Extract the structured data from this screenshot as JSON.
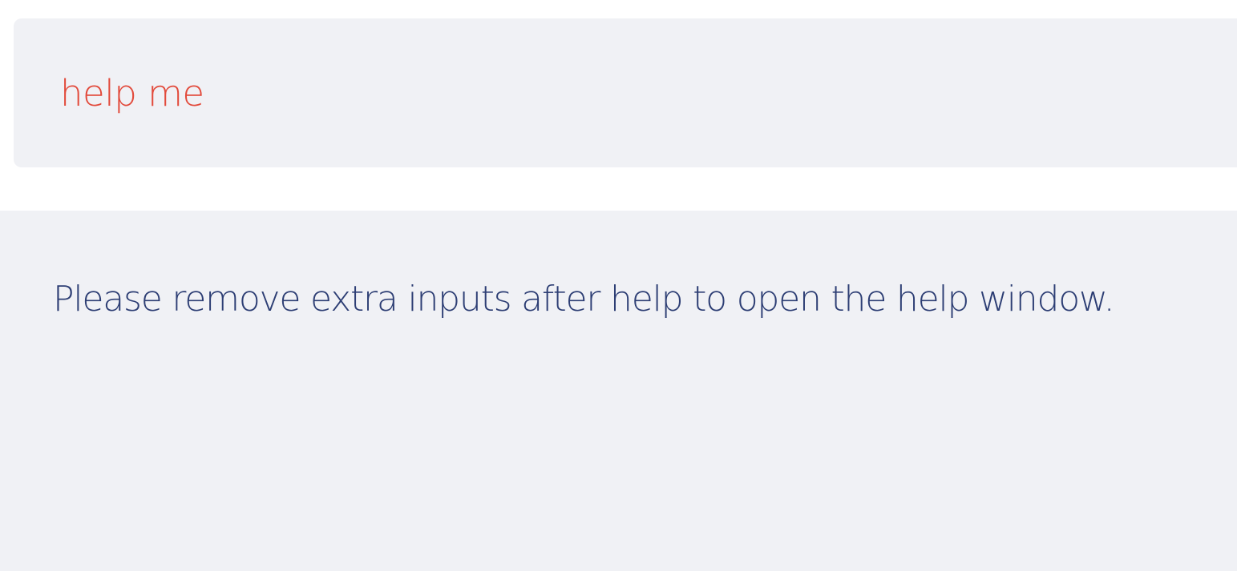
{
  "command": {
    "text": "help me",
    "color": "#e24a3b"
  },
  "result": {
    "message": "Please remove extra inputs after help to open the help window.",
    "color": "#2d3e74"
  },
  "theme": {
    "panel_background": "#f0f1f5",
    "page_background": "#ffffff"
  }
}
